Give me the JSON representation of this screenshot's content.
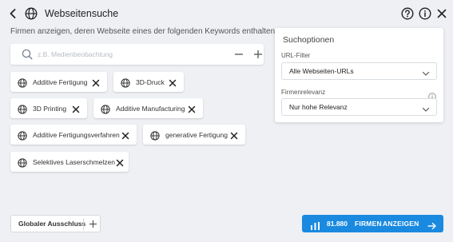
{
  "header": {
    "title": "Webseitensuche",
    "icons": [
      "back-icon",
      "globe-icon",
      "help-icon",
      "info-icon",
      "close-icon"
    ]
  },
  "prompt": "Firmen anzeigen, deren Webseite eines der folgenden Keywords enthalten:",
  "search": {
    "placeholder": "z.B. Medienbeobachtung",
    "value": ""
  },
  "keywords": [
    "Additive Fertigung",
    "3D-Druck",
    "3D Printing",
    "Additive Manufacturing",
    "Additive Fertigungsverfahren",
    "generative Fertigung",
    "Selektives Laserschmelzen"
  ],
  "options": {
    "title": "Suchoptionen",
    "url_filter_label": "URL-Filter",
    "url_filter_value": "Alle Webseiten-URLs",
    "relevance_label": "Firmenrelevanz",
    "relevance_value": "Nur hohe Relevanz"
  },
  "footer": {
    "exclusion_label": "Globaler Ausschluss",
    "cta_count": "81.880",
    "cta_firmen": "FIRMEN",
    "cta_anzeigen": "ANZEIGEN"
  },
  "colors": {
    "accent": "#1a8ae0",
    "background": "#eef0f4"
  }
}
